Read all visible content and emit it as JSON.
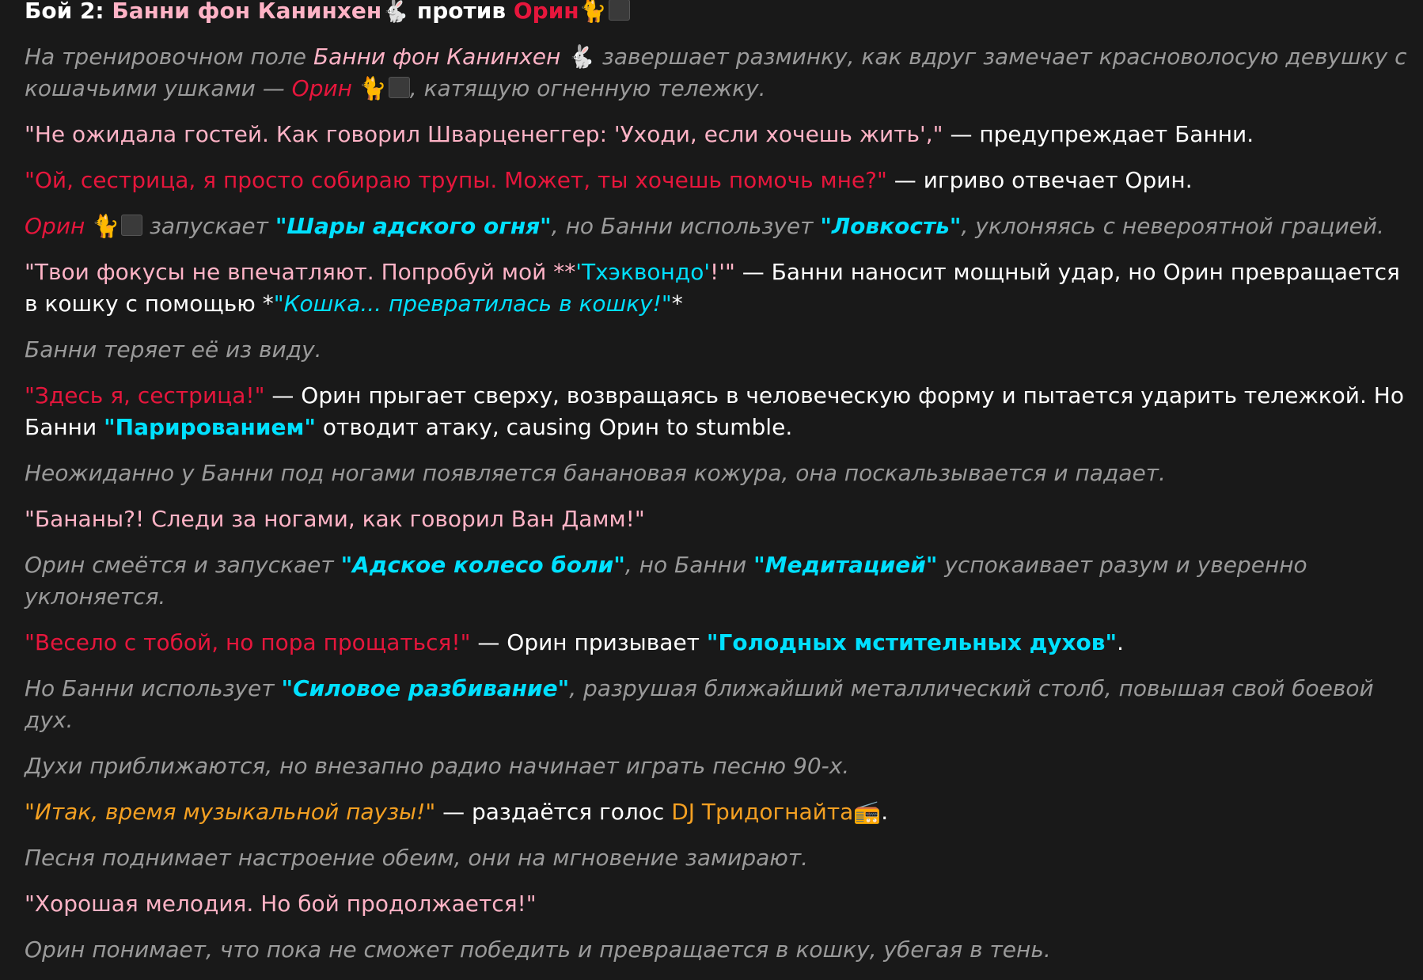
{
  "title": {
    "prefix": "Бой 2: ",
    "bunny": "Банни фон Канинхен",
    "bunny_emoji": "🐇",
    "vs": " против ",
    "orin": "Орин",
    "orin_emoji": "🐈"
  },
  "p1": {
    "a": "На тренировочном поле ",
    "bunny": "Банни фон Канинхен",
    "bunny_emoji": "🐇",
    "b": " завершает разминку, как вдруг замечает красноволосую девушку с кошачьими ушками — ",
    "orin": "Орин",
    "orin_emoji": "🐈",
    "c": ", катящую огненную тележку."
  },
  "p2": {
    "quote": "\"Не ожидала гостей. Как говорил Шварценеггер: 'Уходи, если хочешь жить',\"",
    "rest": " — предупреждает Банни."
  },
  "p3": {
    "quote": "\"Ой, сестрица, я просто собираю трупы. Может, ты хочешь помочь мне?\"",
    "rest": " — игриво отвечает Орин."
  },
  "p4": {
    "orin": "Орин",
    "orin_emoji": "🐈",
    "a": " запускает ",
    "skill1": "\"Шары адского огня\"",
    "b": ", но Банни использует ",
    "skill2": "\"Ловкость\"",
    "c": ", уклоняясь с невероятной грацией."
  },
  "p5": {
    "quote": "\"Твои фокусы не впечатляют. Попробуй мой **",
    "skill": "'Тхэквондо'",
    "quote_end": "!'\"",
    "rest": " — Банни наносит мощный удар, но Орин превращается в кошку с помощью *",
    "skill2": "\"Кошка... превратилась в кошку!\"",
    "end": "*"
  },
  "p6": {
    "text": "Банни теряет её из виду."
  },
  "p7": {
    "quote": "\"Здесь я, сестрица!\"",
    "rest": " — Орин прыгает сверху, возвращаясь в человеческую форму и пытается ударить тележкой. Но Банни ",
    "skill": "\"Парированием\"",
    "end": " отводит атаку, causing Орин to stumble."
  },
  "p8": {
    "text": "Неожиданно у Банни под ногами появляется банановая кожура, она поскальзывается и падает."
  },
  "p9": {
    "quote": "\"Бананы?! Следи за ногами, как говорил Ван Дамм!\""
  },
  "p10": {
    "a": "Орин смеётся и запускает ",
    "skill1": "\"Адское колесо боли\"",
    "b": ", но Банни ",
    "skill2": "\"Медитацией\"",
    "c": " успокаивает разум и уверенно уклоняется."
  },
  "p11": {
    "quote": "\"Весело с тобой, но пора прощаться!\"",
    "rest": " — Орин призывает ",
    "skill": "\"Голодных мстительных духов\"",
    "end": "."
  },
  "p12": {
    "a": "Но Банни использует ",
    "skill": "\"Силовое разбивание\"",
    "b": ", разрушая ближайший металлический столб, повышая свой боевой дух."
  },
  "p13": {
    "text": "Духи приближаются, но внезапно радио начинает играть песню 90-х."
  },
  "p14": {
    "quote": "\"Итак, время музыкальной паузы!\"",
    "rest": " — раздаётся голос ",
    "dj": "DJ Тридогнайта",
    "dj_emoji": "📻",
    "end": "."
  },
  "p15": {
    "text": "Песня поднимает настроение обеим, они на мгновение замирают."
  },
  "p16": {
    "quote": "\"Хорошая мелодия. Но бой продолжается!\""
  },
  "p17": {
    "text": "Орин понимает, что пока не сможет победить и превращается в кошку, убегая в тень."
  }
}
